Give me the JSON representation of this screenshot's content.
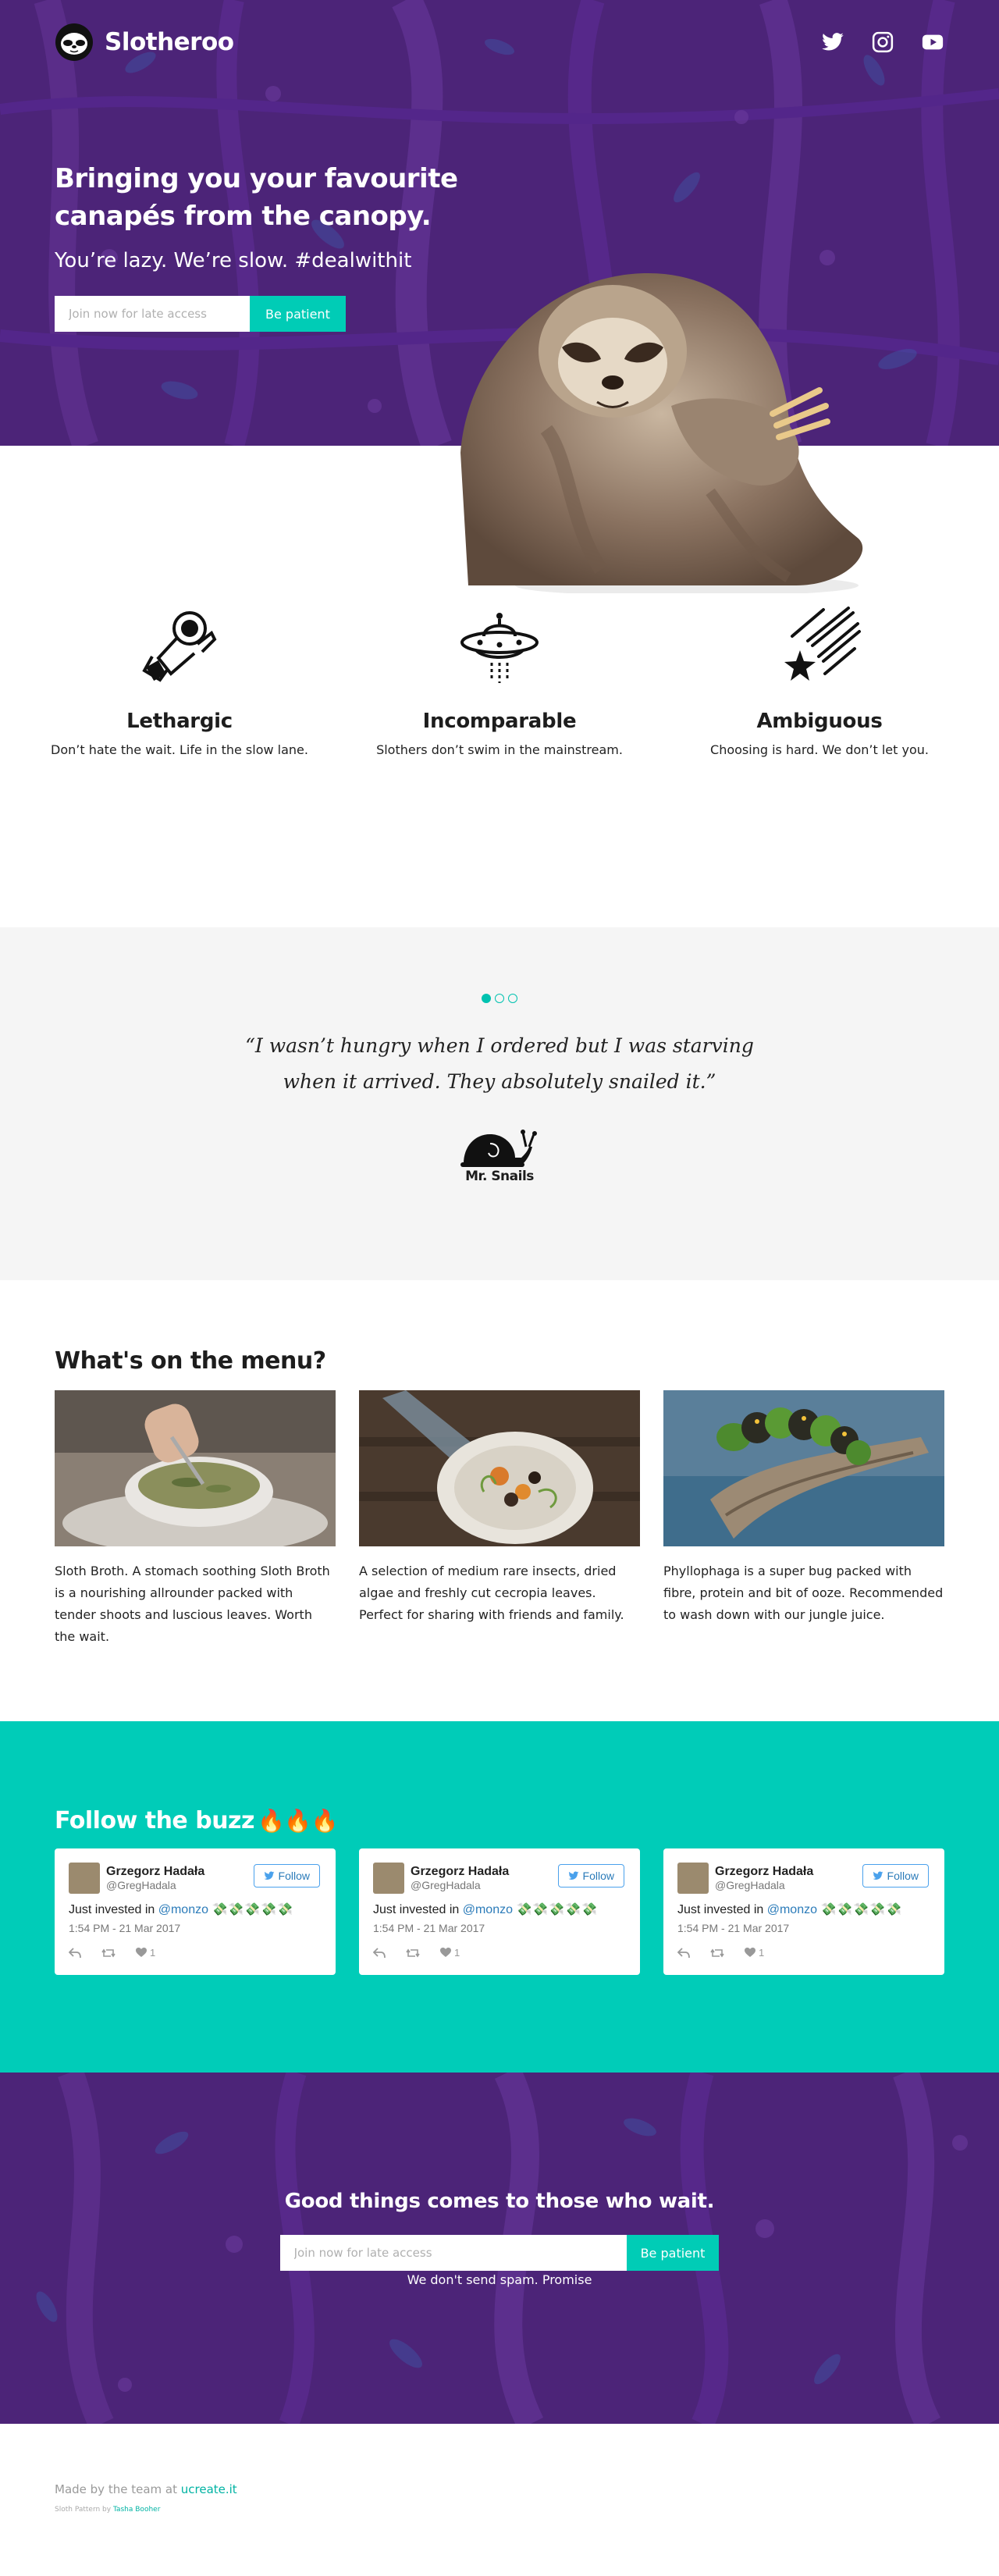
{
  "nav": {
    "brand": "Slotheroo",
    "socials": [
      {
        "icon": "twitter-icon"
      },
      {
        "icon": "instagram-icon"
      },
      {
        "icon": "youtube-icon"
      }
    ]
  },
  "hero": {
    "title_line1": "Bringing you your favourite",
    "title_line2": "canapés from the canopy.",
    "subtitle": "You’re lazy. We’re slow. #dealwithit",
    "email_placeholder": "Join now for late access",
    "button": "Be patient"
  },
  "features": [
    {
      "icon": "astronaut-icon",
      "title": "Lethargic",
      "text": "Don’t hate the wait. Life in the slow lane."
    },
    {
      "icon": "ufo-icon",
      "title": "Incomparable",
      "text": "Slothers don’t swim in the mainstream."
    },
    {
      "icon": "shooting-star-icon",
      "title": "Ambiguous",
      "text": "Choosing is hard. We don’t let you."
    }
  ],
  "testimonial": {
    "quote": "“I wasn’t hungry when I ordered but I was starving when it arrived. They absolutely snailed it.”",
    "author": "Mr. Snails",
    "slides": 3,
    "active_slide": 1
  },
  "menu": {
    "title": "What's on the menu?",
    "items": [
      {
        "image": "sloth-broth-photo",
        "text": "Sloth Broth. A stomach soothing Sloth Broth is a nourishing allrounder packed with tender shoots and luscious leaves. Worth the wait."
      },
      {
        "image": "insect-salad-photo",
        "text": "A selection of medium rare insects, dried algae and freshly cut cecropia leaves. Perfect for sharing with friends and family."
      },
      {
        "image": "caterpillar-photo",
        "text": "Phyllophaga is a super bug packed with fibre, protein and bit of ooze. Recommended to wash down with our jungle juice."
      }
    ]
  },
  "buzz": {
    "title": "Follow the buzz",
    "emoji": "🔥🔥🔥",
    "tweets": [
      {
        "name": "Grzegorz Hadała",
        "handle": "@GregHadala",
        "follow": "Follow",
        "text": "Just invested in",
        "mention": "@monzo",
        "money": "💸💸💸💸💸",
        "time": "1:54 PM - 21 Mar 2017",
        "likes": "1"
      },
      {
        "name": "Grzegorz Hadała",
        "handle": "@GregHadala",
        "follow": "Follow",
        "text": "Just invested in",
        "mention": "@monzo",
        "money": "💸💸💸💸💸",
        "time": "1:54 PM - 21 Mar 2017",
        "likes": "1"
      },
      {
        "name": "Grzegorz Hadała",
        "handle": "@GregHadala",
        "follow": "Follow",
        "text": "Just invested in",
        "mention": "@monzo",
        "money": "💸💸💸💸💸",
        "time": "1:54 PM - 21 Mar 2017",
        "likes": "1"
      }
    ]
  },
  "cta": {
    "title": "Good things comes to those who wait.",
    "email_placeholder": "Join now for late access",
    "button": "Be patient",
    "note": "We don't send spam. Promise"
  },
  "footer": {
    "made_by": "Made by the team at",
    "made_by_link": "ucreate.it",
    "pattern_credit": "Sloth Pattern by",
    "pattern_author": "Tasha Booher"
  },
  "colors": {
    "purple": "#4c2478",
    "teal": "#00ccb8",
    "link_blue": "#2b7bb9"
  }
}
